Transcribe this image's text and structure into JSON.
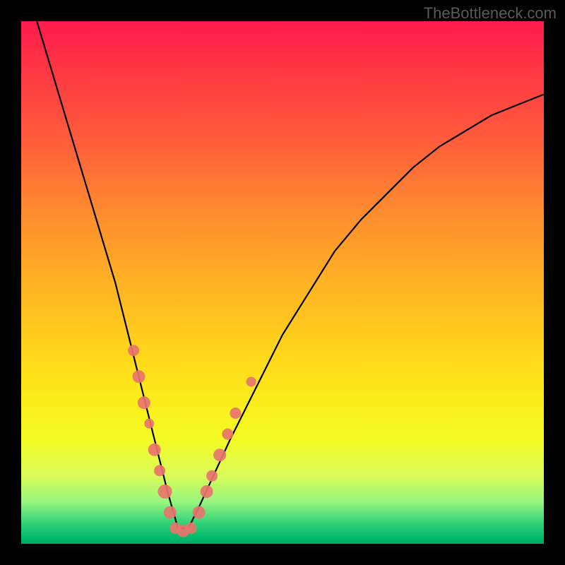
{
  "watermark": "TheBottleneck.com",
  "chart_data": {
    "type": "line",
    "title": "",
    "xlabel": "",
    "ylabel": "",
    "xlim": [
      0,
      100
    ],
    "ylim": [
      0,
      100
    ],
    "gradient_stops": [
      {
        "pos": 0,
        "color": "#ff1a4d"
      },
      {
        "pos": 8,
        "color": "#ff3344"
      },
      {
        "pos": 22,
        "color": "#ff5a3c"
      },
      {
        "pos": 36,
        "color": "#ff8a2f"
      },
      {
        "pos": 50,
        "color": "#ffb224"
      },
      {
        "pos": 62,
        "color": "#ffd21b"
      },
      {
        "pos": 72,
        "color": "#fcec1a"
      },
      {
        "pos": 80,
        "color": "#f4fb24"
      },
      {
        "pos": 87,
        "color": "#d9fb59"
      },
      {
        "pos": 92,
        "color": "#97f57e"
      },
      {
        "pos": 96,
        "color": "#32d27a"
      },
      {
        "pos": 99,
        "color": "#00b86b"
      },
      {
        "pos": 100,
        "color": "#00a862"
      }
    ],
    "series": [
      {
        "name": "bottleneck-curve",
        "x": [
          3,
          6,
          9,
          12,
          15,
          18,
          20,
          22,
          24,
          26,
          28,
          30,
          32,
          34,
          40,
          45,
          50,
          55,
          60,
          65,
          70,
          75,
          80,
          85,
          90,
          95,
          100
        ],
        "y": [
          100,
          90,
          80,
          70,
          60,
          50,
          42,
          34,
          26,
          18,
          10,
          3,
          3,
          7,
          20,
          30,
          40,
          48,
          56,
          62,
          67,
          72,
          76,
          79,
          82,
          84,
          86
        ]
      }
    ],
    "markers": [
      {
        "x": 21.5,
        "y": 37,
        "r": 8,
        "color": "#e8746c"
      },
      {
        "x": 22.5,
        "y": 32,
        "r": 9,
        "color": "#e8746c"
      },
      {
        "x": 23.5,
        "y": 27,
        "r": 9,
        "color": "#e8746c"
      },
      {
        "x": 24.5,
        "y": 23,
        "r": 7,
        "color": "#e8746c"
      },
      {
        "x": 25.5,
        "y": 18,
        "r": 9,
        "color": "#e8746c"
      },
      {
        "x": 26.5,
        "y": 14,
        "r": 8,
        "color": "#e8746c"
      },
      {
        "x": 27.5,
        "y": 10,
        "r": 10,
        "color": "#e8746c"
      },
      {
        "x": 28.5,
        "y": 6,
        "r": 9,
        "color": "#e8746c"
      },
      {
        "x": 29.5,
        "y": 3,
        "r": 8,
        "color": "#e8746c"
      },
      {
        "x": 31.0,
        "y": 2.5,
        "r": 9,
        "color": "#e8746c"
      },
      {
        "x": 32.5,
        "y": 3,
        "r": 8,
        "color": "#e8746c"
      },
      {
        "x": 34.0,
        "y": 6,
        "r": 9,
        "color": "#e8746c"
      },
      {
        "x": 35.5,
        "y": 10,
        "r": 9,
        "color": "#e8746c"
      },
      {
        "x": 36.5,
        "y": 13,
        "r": 8,
        "color": "#e8746c"
      },
      {
        "x": 38.0,
        "y": 17,
        "r": 9,
        "color": "#e8746c"
      },
      {
        "x": 39.5,
        "y": 21,
        "r": 8,
        "color": "#e8746c"
      },
      {
        "x": 41.0,
        "y": 25,
        "r": 8,
        "color": "#e8746c"
      },
      {
        "x": 44.0,
        "y": 31,
        "r": 7,
        "color": "#e8746c"
      }
    ]
  }
}
